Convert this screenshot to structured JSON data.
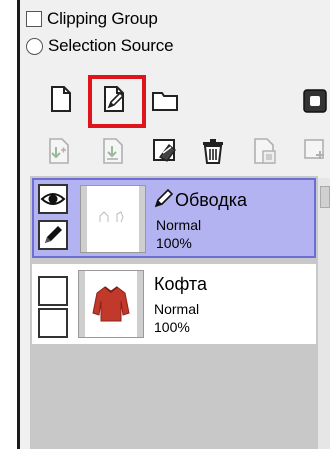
{
  "options": {
    "clipping_group_label": "Clipping Group",
    "selection_source_label": "Selection Source"
  },
  "toolbar": {
    "row1": [
      "new-layer-icon",
      "new-vector-layer-icon",
      "new-folder-icon",
      "layer-mask-icon"
    ],
    "row2": [
      "transfer-down-icon",
      "merge-down-icon",
      "clear-layer-icon",
      "delete-layer-icon",
      "apply-mask-icon",
      "new-layer-mask-icon"
    ],
    "highlight_color": "#e0141c"
  },
  "layers": [
    {
      "name": "Обводка",
      "mode": "Normal",
      "opacity": "100%",
      "selected": true,
      "type": "vector"
    },
    {
      "name": "Кофта",
      "mode": "Normal",
      "opacity": "100%",
      "selected": false,
      "type": "raster"
    }
  ],
  "colors": {
    "selected_bg": "#b3b3f2",
    "selected_border": "#6d6dd6",
    "panel_bg": "#f0f0f0",
    "list_bg": "#c8c8c8"
  }
}
